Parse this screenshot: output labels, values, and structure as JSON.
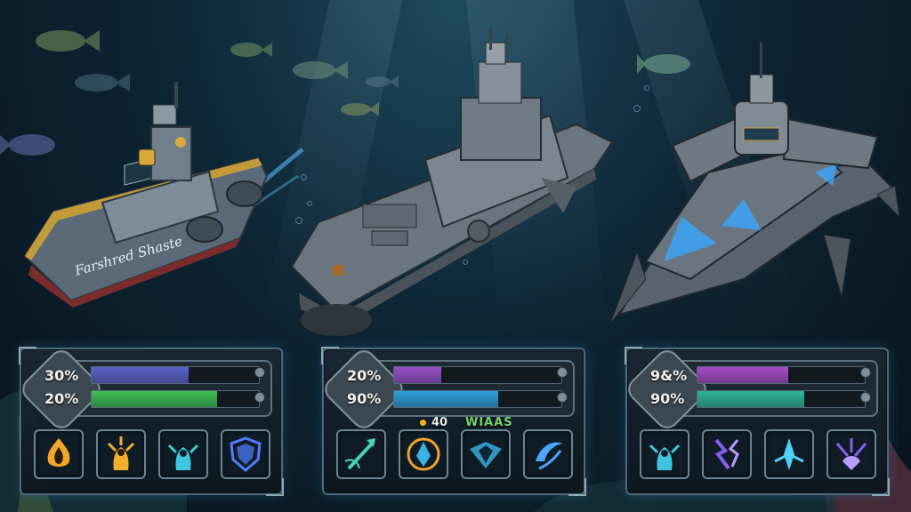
{
  "ships": [
    {
      "name_on_hull": "Farshred Shaste",
      "stats": [
        {
          "label": "30%",
          "value": 0.58,
          "color": "#5b62c9"
        },
        {
          "label": "20%",
          "value": 0.75,
          "color": "#3fbf56"
        }
      ],
      "abilities": [
        {
          "icon": "flame-burst-icon",
          "color": "#f1a627"
        },
        {
          "icon": "fire-warrior-icon",
          "color": "#f0b02a"
        },
        {
          "icon": "water-warrior-icon",
          "color": "#3fc7e0"
        },
        {
          "icon": "energy-shield-icon",
          "color": "#4f7dff"
        }
      ]
    },
    {
      "stats": [
        {
          "label": "20%",
          "value": 0.28,
          "color": "#9650c8"
        },
        {
          "label": "90%",
          "value": 0.62,
          "color": "#2e9fdb"
        }
      ],
      "counter": {
        "value": "40",
        "dot_color": "#f1b21e"
      },
      "tag": "WIAAS",
      "abilities": [
        {
          "icon": "trident-strike-icon",
          "color": "#47d3b4"
        },
        {
          "icon": "crystal-burst-icon",
          "color": "#f0a32c"
        },
        {
          "icon": "water-shield-icon",
          "color": "#3cb3e8"
        },
        {
          "icon": "vortex-slash-icon",
          "color": "#4aa6ff"
        }
      ]
    },
    {
      "stats": [
        {
          "label": "9&%",
          "value": 0.54,
          "color": "#a34bc4"
        },
        {
          "label": "90%",
          "value": 0.64,
          "color": "#2fb496"
        }
      ],
      "abilities": [
        {
          "icon": "water-warrior-icon",
          "color": "#40c3e3"
        },
        {
          "icon": "lightning-rune-icon",
          "color": "#8a5cf0"
        },
        {
          "icon": "ice-crystal-icon",
          "color": "#4fd0f5"
        },
        {
          "icon": "claw-strike-icon",
          "color": "#8a5cf0"
        }
      ]
    }
  ]
}
